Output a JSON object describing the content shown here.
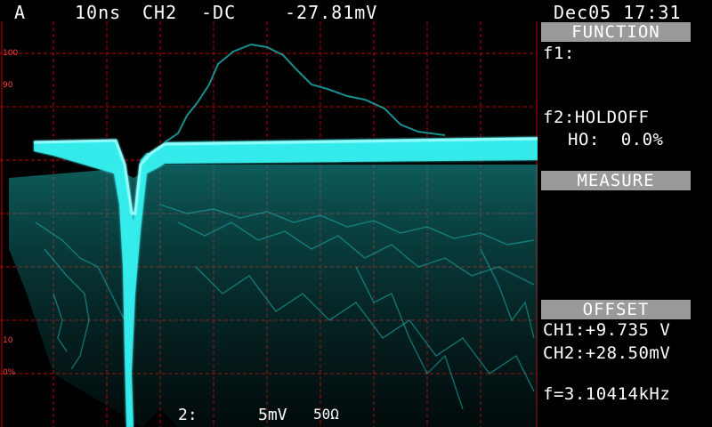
{
  "header": {
    "trigger_mode": "A",
    "timebase": "10ns",
    "channel": "CH2",
    "coupling": "-DC",
    "trigger_level": "-27.81mV",
    "datetime": "Dec05 17:31"
  },
  "graticule_labels": {
    "top_100": "100",
    "top_90": "90",
    "bottom_10": "10",
    "bottom_0": "0%"
  },
  "bottom_readout": {
    "channel_num": "2:",
    "volts_div": "5mV",
    "impedance": "50Ω"
  },
  "function_panel": {
    "title": "FUNCTION",
    "f1": "f1:",
    "f2": "f2:HOLDOFF",
    "holdoff": "HO:  0.0%"
  },
  "measure_panel": {
    "title": "MEASURE"
  },
  "offset_panel": {
    "title": "OFFSET",
    "ch1": "CH1:+9.735 V",
    "ch2": "CH2:+28.50mV",
    "frequency": "f=3.10414kHz"
  },
  "colors": {
    "grid": "#c00000",
    "trace": "#22e6e6",
    "header_bg": "#9a9a9a"
  }
}
